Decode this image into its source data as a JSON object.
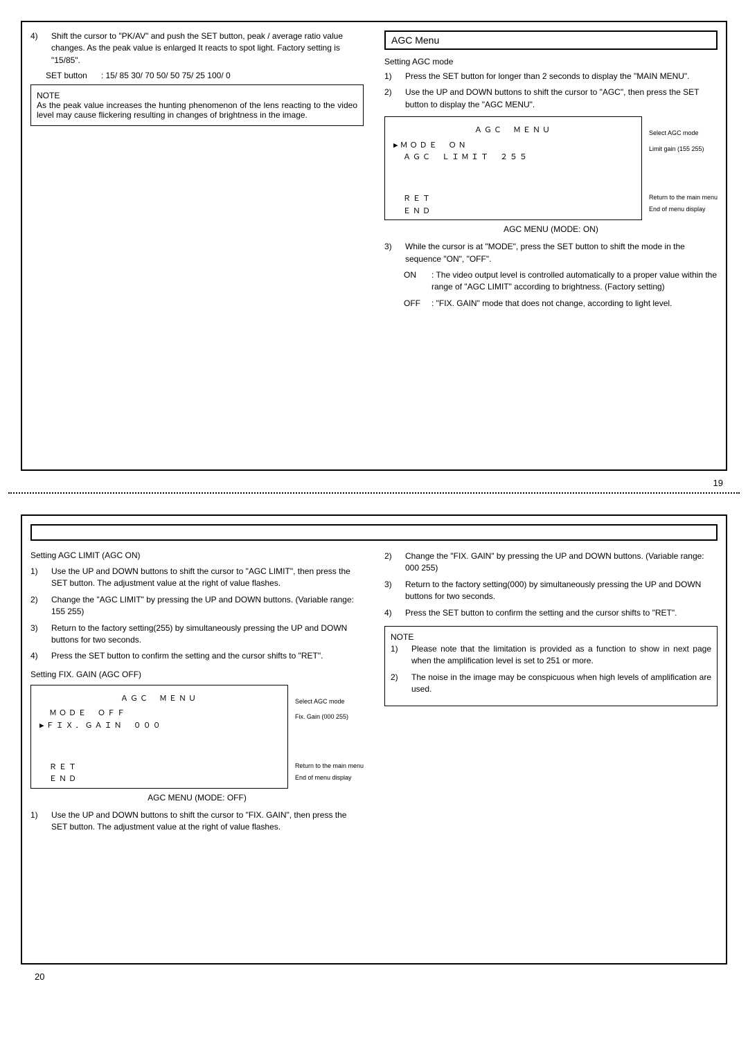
{
  "top": {
    "left": {
      "item4_a": "Shift the cursor to \"PK/AV\" and push the SET button, peak / average ratio value changes. As the peak value is enlarged It reacts to spot light. Factory setting is \"15/85\".",
      "setbtn_label": "SET button",
      "setbtn_vals": ": 15/ 85   30/ 70   50/ 50   75/ 25   100/   0",
      "note_hd": "NOTE",
      "note_body": "As the peak value increases the hunting phenomenon of the lens reacting to the video level may cause flickering resulting in changes of brightness in the image."
    },
    "right": {
      "heading": "AGC Menu",
      "subhead": "Setting AGC mode",
      "step1": "Press the SET button for longer than 2 seconds to display the \"MAIN MENU\".",
      "step2": "Use the UP and DOWN buttons to shift the cursor to \"AGC\", then press the SET button to display the \"AGC MENU\".",
      "menu": {
        "title": "ＡＧＣ　ＭＥＮＵ",
        "line_mode": "▶ＭＯＤＥ　ＯＮ",
        "line_limit": "　ＡＧＣ　ＬＩＭＩＴ　２５５",
        "ret": "　ＲＥＴ",
        "end": "　ＥＮＤ",
        "ann_mode": "Select AGC mode",
        "ann_limit": "Limit gain (155   255)",
        "ann_ret": "Return to the main menu",
        "ann_end": "End of menu display"
      },
      "menu_caption": "AGC MENU (MODE: ON)",
      "step3": "While the cursor is at \"MODE\", press the SET button to shift the mode in the sequence \"ON\", \"OFF\".",
      "on_lbl": "ON",
      "on_txt": ": The video output level is controlled automatically to a proper value within the range of \"AGC LIMIT\" according to brightness. (Factory setting)",
      "off_lbl": "OFF",
      "off_txt": ": \"FIX. GAIN\" mode that does not change, according to light level."
    },
    "pagenum": "19"
  },
  "bottom": {
    "left": {
      "h1": "Setting AGC LIMIT (AGC ON)",
      "s1": "Use the UP and DOWN buttons to shift the cursor to \"AGC LIMIT\", then press the SET button. The adjustment value at the right of value flashes.",
      "s2": "Change the \"AGC LIMIT\" by pressing the UP and DOWN buttons. (Variable range: 155   255)",
      "s3": "Return to the factory setting(255) by simultaneously pressing the UP and DOWN buttons for two seconds.",
      "s4": "Press the SET button to confirm the setting and the cursor shifts to \"RET\".",
      "h2": "Setting FIX. GAIN (AGC OFF)",
      "menu": {
        "title": "ＡＧＣ　ＭＥＮＵ",
        "line_mode": "　ＭＯＤＥ　ＯＦＦ",
        "line_fix": "▶ＦＩＸ．ＧＡＩＮ　０００",
        "ret": "　ＲＥＴ",
        "end": "　ＥＮＤ",
        "ann_mode": "Select AGC mode",
        "ann_fix": "Fix. Gain (000   255)",
        "ann_ret": "Return to the main menu",
        "ann_end": "End of menu display"
      },
      "menu_caption": "AGC MENU (MODE: OFF)",
      "s5": "Use the UP and DOWN buttons to shift the cursor to \"FIX. GAIN\", then press the SET button. The adjustment value at the right of value flashes."
    },
    "right": {
      "s2": "Change the \"FIX. GAIN\" by pressing the UP and DOWN buttons. (Variable range: 000   255)",
      "s3": "Return to the factory setting(000) by simultaneously pressing the UP and DOWN buttons for two seconds.",
      "s4": "Press the SET button to confirm the setting and the cursor shifts to \"RET\".",
      "note_hd": "NOTE",
      "note1": "Please note that the limitation is provided as a function to show in next page when the amplification level is set to 251 or more.",
      "note2": "The noise in the image may be conspicuous when high levels of amplification are used."
    },
    "pagenum": "20"
  }
}
